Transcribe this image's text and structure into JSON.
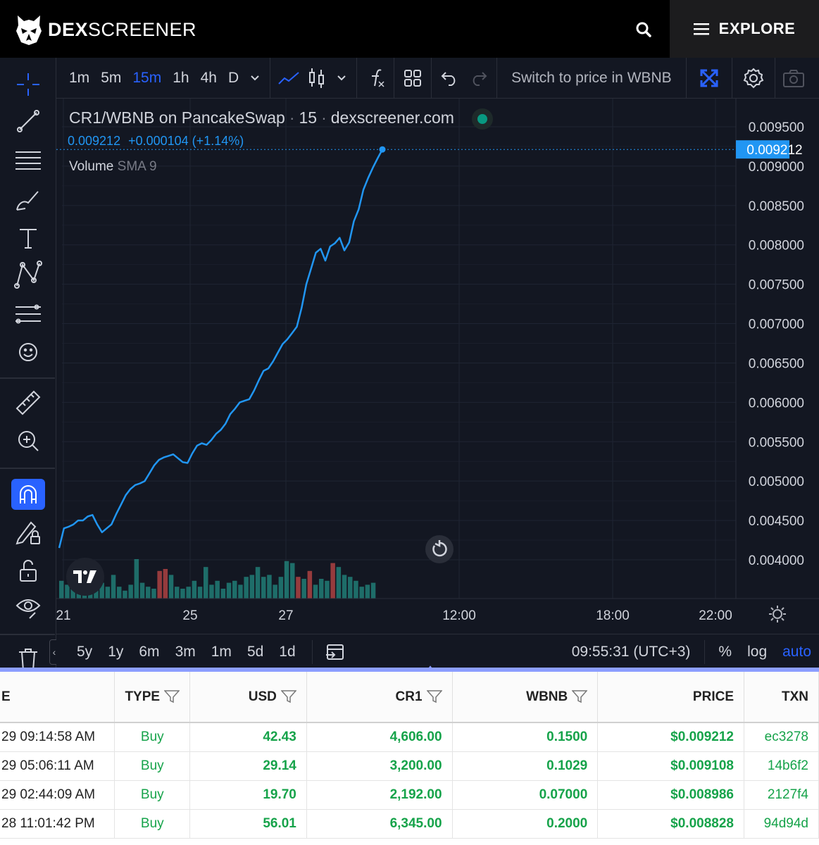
{
  "topbar": {
    "logo_bold": "DEX",
    "logo_light": "SCREENER",
    "explore_label": "EXPLORE",
    "search_icon": "search-icon",
    "menu_icon": "hamburger-icon"
  },
  "header": {
    "timeframes": [
      "1m",
      "5m",
      "15m",
      "1h",
      "4h",
      "D"
    ],
    "active_timeframe": "15m",
    "switch_label": "Switch to price in WBNB"
  },
  "legend": {
    "symbol": "CR1/WBNB on PancakeSwap",
    "interval": "15",
    "source": "dexscreener.com",
    "price": "0.009212",
    "change": "+0.000104 (+1.14%)",
    "volume_label": "Volume",
    "volume_sma": "SMA 9"
  },
  "price_axis": {
    "labels": [
      "0.009500",
      "0.009000",
      "0.008500",
      "0.008000",
      "0.007500",
      "0.007000",
      "0.006500",
      "0.006000",
      "0.005500",
      "0.005000",
      "0.004500",
      "0.004000"
    ],
    "current_price": "0.009212"
  },
  "time_axis": {
    "labels": [
      "21",
      "25",
      "27",
      "12:00",
      "18:00",
      "22:00"
    ]
  },
  "bottom_toolbar": {
    "ranges": [
      "5y",
      "1y",
      "6m",
      "3m",
      "1m",
      "5d",
      "1d"
    ],
    "time": "09:55:31 (UTC+3)",
    "percent": "%",
    "log": "log",
    "auto": "auto"
  },
  "chart_data": {
    "type": "line",
    "title": "CR1/WBNB on PancakeSwap",
    "ylim": [
      0.0036,
      0.0097
    ],
    "y": [
      0.00415,
      0.0044,
      0.00442,
      0.00445,
      0.0045,
      0.0045,
      0.00455,
      0.00457,
      0.00445,
      0.00435,
      0.0044,
      0.00445,
      0.00458,
      0.0047,
      0.00482,
      0.0049,
      0.00495,
      0.00497,
      0.005,
      0.0051,
      0.0052,
      0.00527,
      0.0053,
      0.00532,
      0.00534,
      0.00529,
      0.00524,
      0.00523,
      0.00535,
      0.00545,
      0.00548,
      0.00546,
      0.00552,
      0.0056,
      0.00565,
      0.00573,
      0.00585,
      0.00592,
      0.006,
      0.00602,
      0.00604,
      0.00615,
      0.00628,
      0.0064,
      0.00643,
      0.00652,
      0.00663,
      0.00674,
      0.0068,
      0.00688,
      0.00696,
      0.0072,
      0.0075,
      0.0077,
      0.0079,
      0.00795,
      0.0078,
      0.00798,
      0.00802,
      0.00809,
      0.00793,
      0.00803,
      0.0083,
      0.00845,
      0.0087,
      0.00885,
      0.00898,
      0.0091,
      0.009212
    ],
    "volume_bars": [
      {
        "v": 0.45,
        "up": true
      },
      {
        "v": 0.35,
        "up": true
      },
      {
        "v": 0.25,
        "up": true
      },
      {
        "v": 0.3,
        "up": true
      },
      {
        "v": 0.95,
        "up": true
      },
      {
        "v": 0.3,
        "up": true
      },
      {
        "v": 0.35,
        "up": true
      },
      {
        "v": 0.4,
        "up": true
      },
      {
        "v": 0.3,
        "up": true
      },
      {
        "v": 0.6,
        "up": true
      },
      {
        "v": 0.3,
        "up": true
      },
      {
        "v": 0.2,
        "up": true
      },
      {
        "v": 0.35,
        "up": true
      },
      {
        "v": 1.0,
        "up": true
      },
      {
        "v": 0.4,
        "up": true
      },
      {
        "v": 0.3,
        "up": true
      },
      {
        "v": 0.25,
        "up": true
      },
      {
        "v": 0.7,
        "up": false
      },
      {
        "v": 0.75,
        "up": false
      },
      {
        "v": 0.6,
        "up": true
      },
      {
        "v": 0.3,
        "up": true
      },
      {
        "v": 0.25,
        "up": true
      },
      {
        "v": 0.3,
        "up": true
      },
      {
        "v": 0.45,
        "up": true
      },
      {
        "v": 0.3,
        "up": true
      },
      {
        "v": 0.8,
        "up": true
      },
      {
        "v": 0.35,
        "up": true
      },
      {
        "v": 0.45,
        "up": true
      },
      {
        "v": 0.25,
        "up": true
      },
      {
        "v": 0.4,
        "up": true
      },
      {
        "v": 0.45,
        "up": true
      },
      {
        "v": 0.35,
        "up": true
      },
      {
        "v": 0.55,
        "up": true
      },
      {
        "v": 0.6,
        "up": true
      },
      {
        "v": 0.8,
        "up": true
      },
      {
        "v": 0.55,
        "up": true
      },
      {
        "v": 0.6,
        "up": true
      },
      {
        "v": 0.35,
        "up": true
      },
      {
        "v": 0.55,
        "up": true
      },
      {
        "v": 0.95,
        "up": true
      },
      {
        "v": 0.9,
        "up": true
      },
      {
        "v": 0.55,
        "up": false
      },
      {
        "v": 0.5,
        "up": true
      },
      {
        "v": 0.7,
        "up": false
      },
      {
        "v": 0.35,
        "up": true
      },
      {
        "v": 0.5,
        "up": true
      },
      {
        "v": 0.45,
        "up": true
      },
      {
        "v": 0.9,
        "up": false
      },
      {
        "v": 0.8,
        "up": true
      },
      {
        "v": 0.6,
        "up": true
      },
      {
        "v": 0.55,
        "up": true
      },
      {
        "v": 0.45,
        "up": true
      },
      {
        "v": 0.3,
        "up": true
      },
      {
        "v": 0.35,
        "up": true
      },
      {
        "v": 0.4,
        "up": true
      }
    ],
    "line_color": "#2196f3",
    "up_color": "#26a69a",
    "down_color": "#ef5350"
  },
  "table": {
    "headers": [
      "E",
      "TYPE",
      "USD",
      "CR1",
      "WBNB",
      "PRICE",
      "TXN"
    ],
    "rows": [
      {
        "date": "29 09:14:58 AM",
        "type": "Buy",
        "usd": "42.43",
        "cr1": "4,606.00",
        "wbnb": "0.1500",
        "price": "$0.009212",
        "txn": "ec3278"
      },
      {
        "date": "29 05:06:11 AM",
        "type": "Buy",
        "usd": "29.14",
        "cr1": "3,200.00",
        "wbnb": "0.1029",
        "price": "$0.009108",
        "txn": "14b6f2"
      },
      {
        "date": "29 02:44:09 AM",
        "type": "Buy",
        "usd": "19.70",
        "cr1": "2,192.00",
        "wbnb": "0.07000",
        "price": "$0.008986",
        "txn": "2127f4"
      },
      {
        "date": "28 11:01:42 PM",
        "type": "Buy",
        "usd": "56.01",
        "cr1": "6,345.00",
        "wbnb": "0.2000",
        "price": "$0.008828",
        "txn": "94d94d"
      }
    ]
  }
}
